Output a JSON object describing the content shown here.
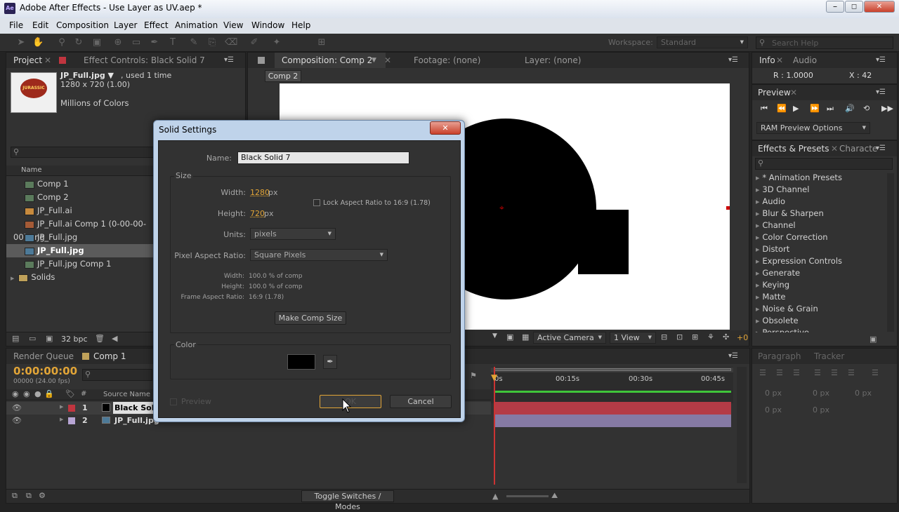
{
  "window": {
    "title": "Adobe After Effects - Use Layer as UV.aep *",
    "app_badge": "Ae",
    "controls": [
      "⎯",
      "◻",
      "✕"
    ]
  },
  "menu": [
    "File",
    "Edit",
    "Composition",
    "Layer",
    "Effect",
    "Animation",
    "View",
    "Window",
    "Help"
  ],
  "toolbar": {
    "workspace_label": "Workspace:",
    "workspace_value": "Standard",
    "search_placeholder": "Search Help"
  },
  "project_panel": {
    "tab_project": "Project",
    "tab_effect_controls": "Effect Controls: Black Solid 7",
    "selected_name": "JP_Full.jpg ▼",
    "selected_usage": ", used 1 time",
    "dimensions": "1280 x 720 (1.00)",
    "colors": "Millions of Colors",
    "thumb_text": "JURASSIC",
    "column_name": "Name",
    "items": [
      {
        "label": "Comp 1",
        "type": "comp"
      },
      {
        "label": "Comp 2",
        "type": "comp"
      },
      {
        "label": "JP_Full.ai",
        "type": "file"
      },
      {
        "label": "JP_Full.ai Comp 1 (0-00-00-00).png",
        "type": "file"
      },
      {
        "label": "JP_Full.jpg",
        "type": "file"
      },
      {
        "label": "JP_Full.jpg",
        "type": "file"
      },
      {
        "label": "JP_Full.jpg Comp 1",
        "type": "comp"
      },
      {
        "label": "Solids",
        "type": "folder"
      }
    ],
    "bpc": "32 bpc"
  },
  "composition_panel": {
    "tab_comp": "Composition: Comp 2",
    "tab_footage": "Footage: (none)",
    "tab_layer": "Layer: (none)",
    "comp_button": "Comp 2",
    "camera": "Active Camera",
    "views": "1 View",
    "exposure": "+0"
  },
  "info_panel": {
    "tab_info": "Info",
    "tab_audio": "Audio",
    "r_value": "R : 1.0000",
    "x_value": "X : 42"
  },
  "preview_panel": {
    "tab": "Preview",
    "ram_preview": "RAM Preview Options"
  },
  "effects_panel": {
    "tab_effects": "Effects & Presets",
    "tab_character": "Characte",
    "items": [
      "* Animation Presets",
      "3D Channel",
      "Audio",
      "Blur & Sharpen",
      "Channel",
      "Color Correction",
      "Distort",
      "Expression Controls",
      "Generate",
      "Keying",
      "Matte",
      "Noise & Grain",
      "Obsolete",
      "Perspective"
    ]
  },
  "paragraph_panel": {
    "tab_paragraph": "Paragraph",
    "tab_tracker": "Tracker",
    "fields": [
      "0 px",
      "0 px",
      "0 px",
      "0 px",
      "0 px"
    ]
  },
  "timeline": {
    "tab_render": "Render Queue",
    "tab_comp1": "Comp 1",
    "timecode": "0:00:00:00",
    "fps": "00000 (24.00 fps)",
    "column_num": "#",
    "column_source": "Source Name",
    "layers": [
      {
        "num": "1",
        "name": "Black Soli",
        "color": "#c0353f"
      },
      {
        "num": "2",
        "name": "JP_Full.jpg",
        "color": "#b7a5d4"
      }
    ],
    "ruler": [
      "0s",
      "00:15s",
      "00:30s",
      "00:45s"
    ],
    "toggle": "Toggle Switches / Modes"
  },
  "dialog": {
    "title": "Solid Settings",
    "close": "✕",
    "name_label": "Name:",
    "name_value": "Black Solid 7",
    "size_group": "Size",
    "width_label": "Width:",
    "width_value": "1280",
    "height_label": "Height:",
    "height_value": "720",
    "unit_px": "px",
    "lock_aspect": "Lock Aspect Ratio to 16:9 (1.78)",
    "units_label": "Units:",
    "units_value": "pixels",
    "par_label": "Pixel Aspect Ratio:",
    "par_value": "Square Pixels",
    "pct_width_label": "Width:",
    "pct_width_value": "100.0 % of comp",
    "pct_height_label": "Height:",
    "pct_height_value": "100.0 % of comp",
    "frame_label": "Frame Aspect Ratio:",
    "frame_value": "16:9 (1.78)",
    "make_comp_size": "Make Comp Size",
    "color_group": "Color",
    "color_value": "#000000",
    "preview": "Preview",
    "ok": "OK",
    "cancel": "Cancel"
  }
}
